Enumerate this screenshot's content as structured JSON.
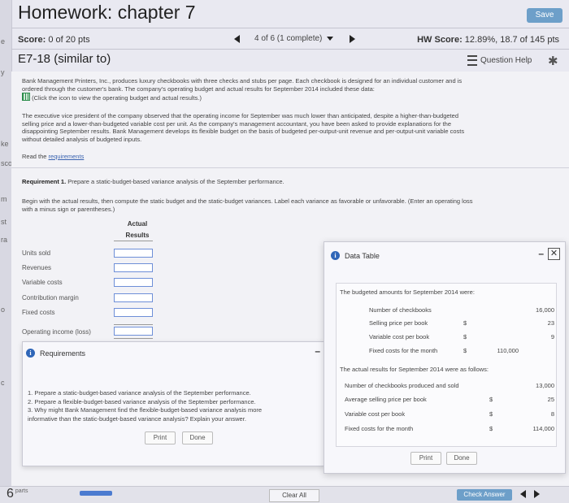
{
  "page_title": "Homework: chapter 7",
  "save_label": "Save",
  "left_strip_letters": [
    "e",
    "y",
    "ke",
    "sco",
    "m",
    "st",
    "ra",
    "o",
    "c"
  ],
  "score": {
    "label": "Score:",
    "value": "0 of 20 pts"
  },
  "navigation": {
    "position": "4 of 6 (1 complete)"
  },
  "hw_score": {
    "label": "HW Score:",
    "value": "12.89%, 18.7 of 145 pts"
  },
  "problem_id": "E7-18 (similar to)",
  "question_help": "Question Help",
  "intro": {
    "line1": "Bank Management Printers, Inc., produces luxury checkbooks with three checks and stubs per page. Each checkbook is designed for an individual customer and is",
    "line2": "ordered through the customer's bank. The company's operating budget and actual results for September 2014 included these data:",
    "click_note": "(Click the icon to view the operating budget and actual results.)"
  },
  "exec": {
    "line1": "The executive vice president of the company observed that the operating income for September was much lower than anticipated, despite a higher-than-budgeted",
    "line2": "selling price and a lower-than-budgeted variable cost per unit. As the company's management accountant, you have been asked to provide explanations for the",
    "line3": "disappointing September results. Bank Management develops its flexible budget on the basis of budgeted per-output-unit revenue and per-output-unit variable costs",
    "line4": "without detailed analysis of budgeted inputs."
  },
  "read_prefix": "Read the",
  "read_link": "requirements",
  "requirement1": {
    "title": "Requirement 1.",
    "text": "Prepare a static-budget-based variance analysis of the September performance.",
    "instr1": "Begin with the actual results, then compute the static budget and the static-budget variances. Label each variance as favorable or unfavorable. (Enter an operating loss",
    "instr2": "with a minus sign or parentheses.)"
  },
  "table": {
    "col_header_1": "Actual",
    "col_header_2": "Results",
    "rows": [
      "Units sold",
      "Revenues",
      "Variable costs",
      "Contribution margin",
      "Fixed costs",
      "Operating income (loss)"
    ]
  },
  "requirements_panel": {
    "title": "Requirements",
    "items": [
      "1.  Prepare a static-budget-based variance analysis of the September performance.",
      "2.  Prepare a flexible-budget-based variance analysis of the September performance.",
      "3.  Why might Bank Management find the flexible-budget-based variance analysis more",
      "     informative than the static-budget-based variance analysis? Explain your answer."
    ],
    "print": "Print",
    "done": "Done"
  },
  "data_table": {
    "title": "Data Table",
    "budgeted_heading": "The budgeted amounts for September 2014 were:",
    "budgeted": [
      {
        "label": "Number of checkbooks",
        "dollar": "",
        "value": "16,000"
      },
      {
        "label": "Selling price per book",
        "dollar": "$",
        "value": "23"
      },
      {
        "label": "Variable cost per book",
        "dollar": "$",
        "value": "9"
      },
      {
        "label": "Fixed costs for the month",
        "dollar": "$",
        "value": "110,000"
      }
    ],
    "actual_heading": "The actual results for September 2014 were as follows:",
    "actual": [
      {
        "label": "Number of checkbooks produced and sold",
        "dollar": "",
        "value": "13,000"
      },
      {
        "label": "Average selling price per book",
        "dollar": "$",
        "value": "25"
      },
      {
        "label": "Variable cost per book",
        "dollar": "$",
        "value": "8"
      },
      {
        "label": "Fixed costs for the month",
        "dollar": "$",
        "value": "114,000"
      }
    ],
    "print": "Print",
    "done": "Done"
  },
  "footer": {
    "parts_count": "6",
    "parts_label": "parts",
    "clear_all": "Clear All",
    "check_answer": "Check Answer"
  },
  "colors": {
    "accent": "#6d9fc9",
    "info_icon": "#2f66b8",
    "link": "#3a63b0",
    "input_border": "#6e8fd8"
  }
}
